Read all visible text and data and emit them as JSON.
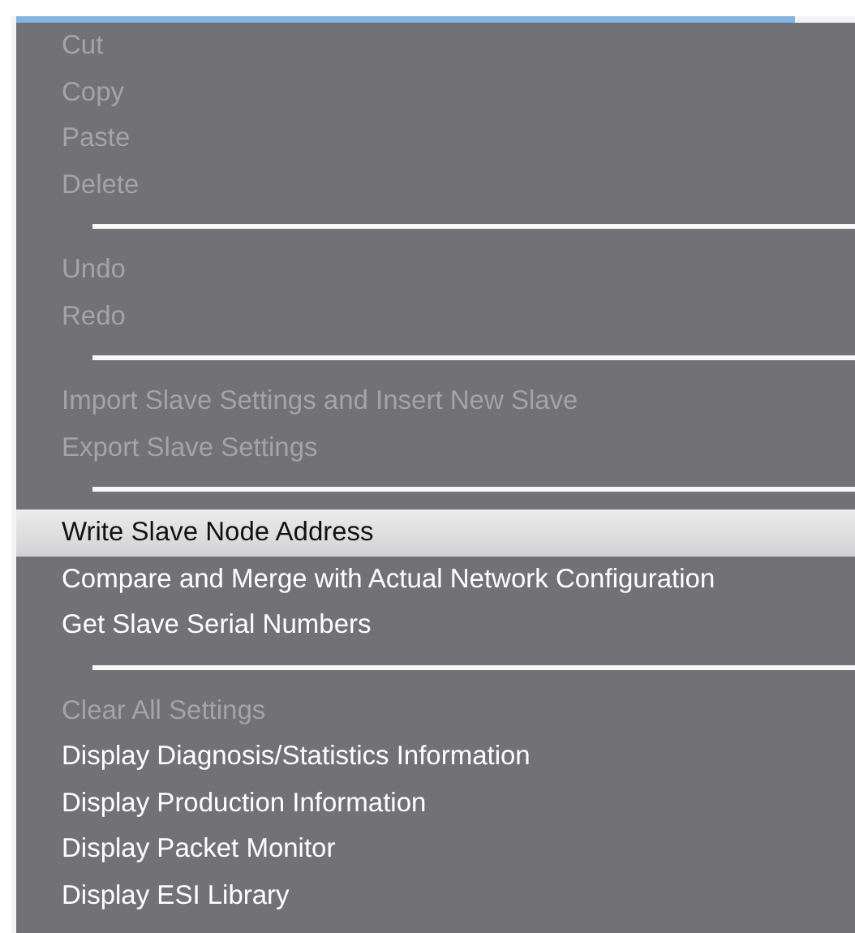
{
  "menu": {
    "items": [
      {
        "kind": "item",
        "label": "Cut",
        "disabled": true,
        "selected": false
      },
      {
        "kind": "item",
        "label": "Copy",
        "disabled": true,
        "selected": false
      },
      {
        "kind": "item",
        "label": "Paste",
        "disabled": true,
        "selected": false
      },
      {
        "kind": "item",
        "label": "Delete",
        "disabled": true,
        "selected": false
      },
      {
        "kind": "separator"
      },
      {
        "kind": "item",
        "label": "Undo",
        "disabled": true,
        "selected": false
      },
      {
        "kind": "item",
        "label": "Redo",
        "disabled": true,
        "selected": false
      },
      {
        "kind": "separator"
      },
      {
        "kind": "item",
        "label": "Import Slave Settings and Insert New Slave",
        "disabled": true,
        "selected": false
      },
      {
        "kind": "item",
        "label": "Export Slave Settings",
        "disabled": true,
        "selected": false
      },
      {
        "kind": "separator"
      },
      {
        "kind": "item",
        "label": "Write Slave Node Address",
        "disabled": false,
        "selected": true
      },
      {
        "kind": "item",
        "label": "Compare and Merge with Actual Network Configuration",
        "disabled": false,
        "selected": false
      },
      {
        "kind": "item",
        "label": "Get Slave Serial Numbers",
        "disabled": false,
        "selected": false
      },
      {
        "kind": "separator"
      },
      {
        "kind": "item",
        "label": "Clear All Settings",
        "disabled": true,
        "selected": false
      },
      {
        "kind": "item",
        "label": "Display Diagnosis/Statistics Information",
        "disabled": false,
        "selected": false
      },
      {
        "kind": "item",
        "label": "Display Production Information",
        "disabled": false,
        "selected": false
      },
      {
        "kind": "item",
        "label": "Display Packet Monitor",
        "disabled": false,
        "selected": false
      },
      {
        "kind": "item",
        "label": "Display ESI Library",
        "disabled": false,
        "selected": false
      }
    ]
  }
}
